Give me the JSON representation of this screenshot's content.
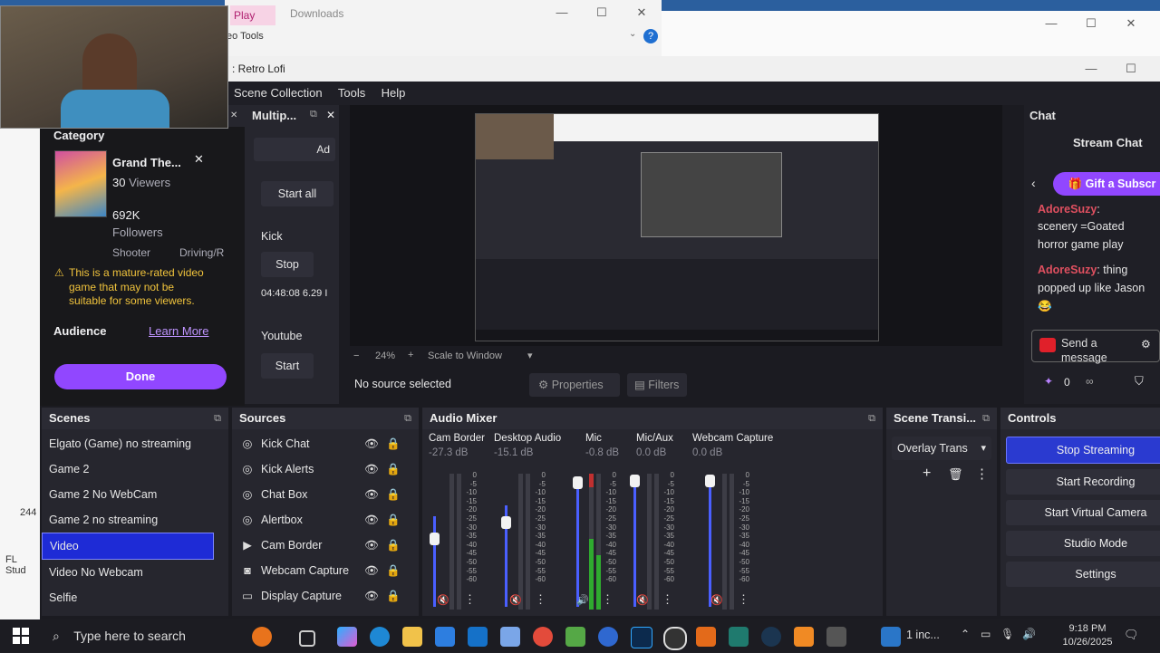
{
  "downloads_window": {
    "tab_play": "Play",
    "title": "Downloads",
    "ribbon_label": "eo Tools"
  },
  "obs": {
    "title": ": Retro Lofi",
    "menu": [
      "Scene Collection",
      "Tools",
      "Help"
    ],
    "multiplatform": {
      "title": "Multip...",
      "add_label": "Ad",
      "start_all": "Start all",
      "kick_label": "Kick",
      "kick_stop": "Stop",
      "kick_timer": "04:48:08 6.29 I",
      "youtube_label": "Youtube",
      "youtube_start": "Start"
    },
    "preview": {
      "zoom": "24%",
      "scale_mode": "Scale to Window",
      "no_source": "No source selected",
      "properties_label": "Properties",
      "filters_label": "Filters"
    },
    "chat": {
      "dock_title": "Chat",
      "stream_chat_title": "Stream Chat",
      "gift_label": "Gift a Subscr",
      "messages": [
        {
          "user": "AdoreSuzy",
          "text": ": "
        },
        {
          "user": "",
          "text": "scenery =Goated horror game play"
        },
        {
          "user": "AdoreSuzy",
          "text": ": thing popped up like Jason 😂"
        }
      ],
      "send_placeholder": "Send a message",
      "points": "0",
      "infinity": "∞"
    },
    "scenes": {
      "title": "Scenes",
      "items": [
        "Elgato (Game) no streaming",
        "Game 2",
        "Game 2 No WebCam",
        "Game 2 no streaming",
        "Video",
        "Video No Webcam",
        "Selfie"
      ],
      "selected_index": 4
    },
    "sources": {
      "title": "Sources",
      "items": [
        {
          "icon": "kick-chat-icon",
          "label": "Kick Chat"
        },
        {
          "icon": "kick-alerts-icon",
          "label": "Kick Alerts"
        },
        {
          "icon": "chat-box-icon",
          "label": "Chat Box"
        },
        {
          "icon": "alertbox-icon",
          "label": "Alertbox"
        },
        {
          "icon": "play-icon",
          "label": "Cam Border"
        },
        {
          "icon": "camera-icon",
          "label": "Webcam Capture"
        },
        {
          "icon": "monitor-icon",
          "label": "Display Capture"
        }
      ]
    },
    "mixer": {
      "title": "Audio Mixer",
      "channels": [
        {
          "name": "Cam Border",
          "db": "-27.3 dB"
        },
        {
          "name": "Desktop Audio",
          "db": "-15.1 dB"
        },
        {
          "name": "Mic",
          "db": "-0.8 dB"
        },
        {
          "name": "Mic/Aux",
          "db": "0.0 dB"
        },
        {
          "name": "Webcam Capture",
          "db": "0.0 dB"
        }
      ],
      "scale": [
        "0",
        "-5",
        "-10",
        "-15",
        "-20",
        "-25",
        "-30",
        "-35",
        "-40",
        "-45",
        "-50",
        "-55",
        "-60"
      ]
    },
    "transitions": {
      "title": "Scene Transi...",
      "selected": "Overlay Trans"
    },
    "controls": {
      "title": "Controls",
      "buttons": [
        "Stop Streaming",
        "Start Recording",
        "Start Virtual Camera",
        "Studio Mode",
        "Settings"
      ]
    }
  },
  "twitch_info": {
    "category_label": "Category",
    "game_title": "Grand The...",
    "viewers_count": "30",
    "viewers_label": "Viewers",
    "followers_count": "692K",
    "followers_label": "Followers",
    "tags": [
      "Shooter",
      "Driving/R"
    ],
    "warning": "This is a mature-rated video game that may not be suitable for some viewers.",
    "audience_label": "Audience",
    "learn_more": "Learn More",
    "done_label": "Done"
  },
  "desktop": {
    "left_text_1": "244",
    "left_text_2": "FL Stud"
  },
  "taskbar": {
    "search_placeholder": "Type here to search",
    "tray_text": "1 inc...",
    "time": "9:18 PM",
    "date": "10/26/2025"
  },
  "colors": {
    "accent": "#2a3ad0",
    "twitch_purple": "#9147ff",
    "warning": "#f0c33c"
  }
}
